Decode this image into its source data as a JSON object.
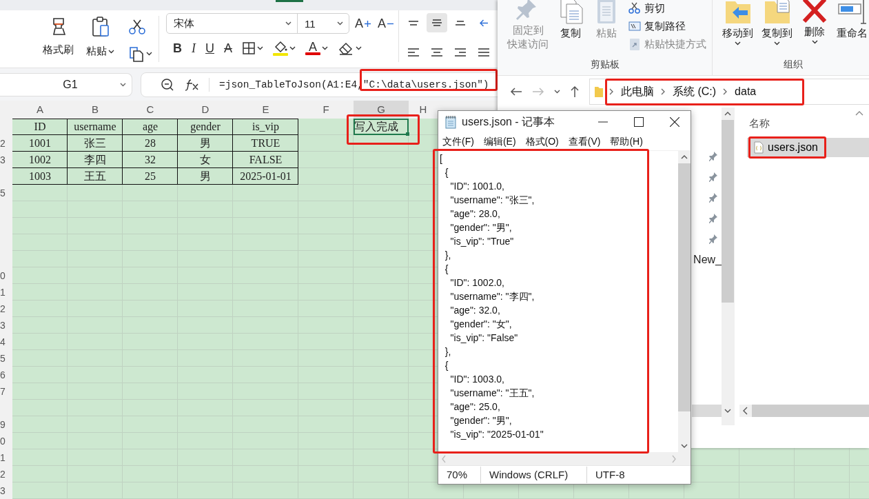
{
  "spreadsheet": {
    "ribbon": {
      "clipboard": [
        {
          "kind": "format_painter",
          "label": "格式刷",
          "dropdown": false
        },
        {
          "kind": "paste",
          "label": "粘贴",
          "dropdown": true
        }
      ],
      "small_tools": [
        {
          "kind": "cut",
          "dropdown": false
        },
        {
          "kind": "copy",
          "dropdown": true
        }
      ],
      "font_name": "宋体",
      "font_size": "11",
      "size_tools": [
        {
          "kind": "grow",
          "label": "A"
        },
        {
          "kind": "shrink",
          "label": "A"
        }
      ],
      "format_tools": [
        {
          "kind": "bold",
          "label": "B",
          "dropdown": false
        },
        {
          "kind": "italic",
          "label": "I",
          "dropdown": false
        },
        {
          "kind": "underline",
          "label": "U",
          "dropdown": false
        },
        {
          "kind": "strike",
          "label": "A",
          "dropdown": false
        },
        {
          "kind": "borders",
          "dropdown": true
        },
        {
          "kind": "fill",
          "dropdown": true,
          "color": "#f2e600"
        },
        {
          "kind": "font_color",
          "label": "A",
          "dropdown": true,
          "color": "#e00000"
        },
        {
          "kind": "eraser",
          "dropdown": true
        }
      ],
      "align_tools": [
        {
          "kind": "top",
          "selected": false
        },
        {
          "kind": "middle",
          "selected": true
        },
        {
          "kind": "bottom",
          "selected": false
        },
        {
          "kind": "indent",
          "selected": false
        },
        {
          "kind": "left",
          "selected": false
        },
        {
          "kind": "center",
          "selected": false
        },
        {
          "kind": "right",
          "selected": false
        },
        {
          "kind": "justify",
          "selected": false
        }
      ]
    },
    "name_box": "G1",
    "formula": {
      "text": "=json_TableToJson(A1:E4,\"C:\\data\\users.json\")",
      "annotated": true
    },
    "columns": [
      {
        "label": "A",
        "selected": false
      },
      {
        "label": "B",
        "selected": false
      },
      {
        "label": "C",
        "selected": false
      },
      {
        "label": "D",
        "selected": false
      },
      {
        "label": "E",
        "selected": false
      },
      {
        "label": "F",
        "selected": false
      },
      {
        "label": "G",
        "selected": true
      },
      {
        "label": "H",
        "selected": false
      }
    ],
    "rows": [
      {
        "cells": [
          "ID",
          "username",
          "age",
          "gender",
          "is_vip"
        ],
        "bordered": true,
        "status_cell": {
          "text": "写入完成",
          "selected": true,
          "annotated": true
        }
      },
      {
        "number": "2",
        "cells": [
          "1001",
          "张三",
          "28",
          "男",
          "TRUE"
        ],
        "bordered": true
      },
      {
        "number": "3",
        "cells": [
          "1002",
          "李四",
          "32",
          "女",
          "FALSE"
        ],
        "bordered": true
      },
      {
        "cells": [
          "1003",
          "王五",
          "25",
          "男",
          "2025-01-01"
        ],
        "bordered": true
      },
      {
        "number": "5",
        "bordered": false
      },
      {
        "bordered": false
      },
      {
        "bordered": false
      },
      {
        "bordered": false
      },
      {
        "bordered": false
      },
      {
        "number": "0",
        "bordered": false
      },
      {
        "number": "1",
        "bordered": false
      },
      {
        "number": "2",
        "bordered": false
      },
      {
        "number": "3",
        "bordered": false
      },
      {
        "number": "4",
        "bordered": false
      },
      {
        "number": "5",
        "bordered": false
      },
      {
        "number": "6",
        "bordered": false
      },
      {
        "number": "7",
        "bordered": false
      },
      {
        "bordered": false
      },
      {
        "number": "9",
        "bordered": false
      },
      {
        "number": "0",
        "bordered": false
      },
      {
        "number": "1",
        "bordered": false
      },
      {
        "number": "2",
        "bordered": false
      },
      {
        "number": "3",
        "bordered": false
      }
    ]
  },
  "explorer": {
    "groups": [
      {
        "label": "剪贴板",
        "items": [
          {
            "kind": "pin",
            "lines": [
              "固定到",
              "快速访问"
            ],
            "disabled": true,
            "dropdown": false
          },
          {
            "kind": "copy",
            "lines": [
              "复制"
            ],
            "disabled": false,
            "dropdown": false
          },
          {
            "kind": "paste",
            "lines": [
              "粘贴"
            ],
            "disabled": true,
            "dropdown": false
          }
        ],
        "small_items": [
          {
            "kind": "cut",
            "label": "剪切",
            "disabled": false
          },
          {
            "kind": "copy_path",
            "label": "复制路径",
            "disabled": false
          },
          {
            "kind": "paste_shortcut",
            "label": "粘贴快捷方式",
            "disabled": true
          }
        ]
      },
      {
        "label": "组织",
        "items": [
          {
            "kind": "move_to",
            "lines": [
              "移动到"
            ],
            "disabled": false,
            "dropdown": true
          },
          {
            "kind": "copy_to",
            "lines": [
              "复制到"
            ],
            "disabled": false,
            "dropdown": true
          },
          {
            "kind": "delete",
            "lines": [
              "删除"
            ],
            "disabled": false,
            "dropdown": true
          },
          {
            "kind": "rename",
            "lines": [
              "重命名"
            ],
            "disabled": false,
            "dropdown": false
          }
        ]
      }
    ],
    "address": {
      "crumbs": [
        "此电脑",
        "系统 (C:)",
        "data"
      ],
      "annotated": true
    },
    "nav_items": [
      {
        "pinned": true
      },
      {
        "pinned": true
      },
      {
        "pinned": true
      },
      {
        "pinned": true
      },
      {
        "pinned": true
      },
      {
        "label": "New_",
        "pinned": false
      }
    ],
    "files": {
      "column": "名称",
      "items": [
        {
          "name": "users.json",
          "selected": true,
          "annotated": true
        }
      ]
    }
  },
  "notepad": {
    "title": "users.json - 记事本",
    "menu": [
      "文件(F)",
      "编辑(E)",
      "格式(O)",
      "查看(V)",
      "帮助(H)"
    ],
    "annotated": true,
    "lines": [
      "[",
      "  {",
      "    \"ID\": 1001.0,",
      "    \"username\": \"张三\",",
      "    \"age\": 28.0,",
      "    \"gender\": \"男\",",
      "    \"is_vip\": \"True\"",
      "  },",
      "  {",
      "    \"ID\": 1002.0,",
      "    \"username\": \"李四\",",
      "    \"age\": 32.0,",
      "    \"gender\": \"女\",",
      "    \"is_vip\": \"False\"",
      "  },",
      "  {",
      "    \"ID\": 1003.0,",
      "    \"username\": \"王五\",",
      "    \"age\": 25.0,",
      "    \"gender\": \"男\",",
      "    \"is_vip\": \"2025-01-01\""
    ],
    "status": [
      "70%",
      "Windows (CRLF)",
      "UTF-8"
    ]
  }
}
